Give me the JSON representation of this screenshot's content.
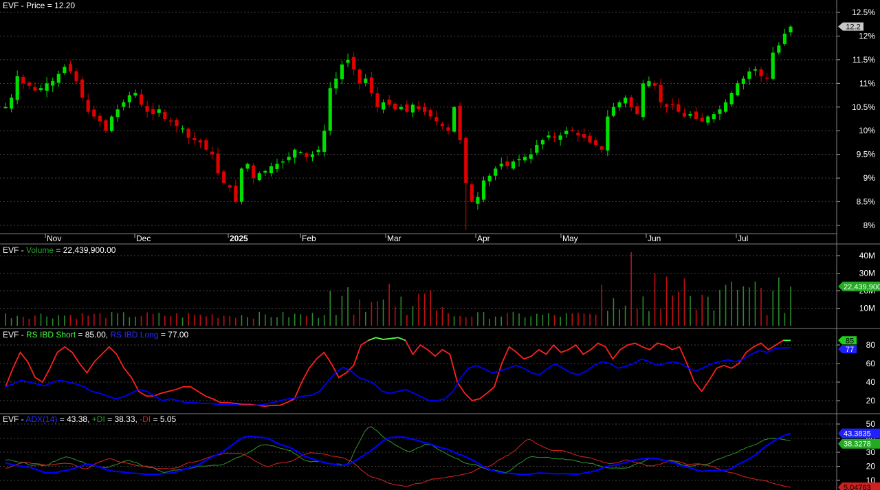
{
  "symbol": "EVF",
  "sep": " - ",
  "eq": " = ",
  "colors": {
    "background": "#000000",
    "up": "#00e000",
    "down": "#e00000",
    "blue": "#0000ff",
    "text": "#ffffff",
    "grid": "#444444",
    "red_line": "#ff2020",
    "green_line": "#44ff44",
    "dark_green": "#2a8a2a",
    "dark_red": "#c01010",
    "di_minus_red": "#d02020"
  },
  "x_axis": {
    "labels": [
      "Nov",
      "Dec",
      "2025",
      "Feb",
      "Mar",
      "Apr",
      "May",
      "Jun",
      "Jul"
    ],
    "bold": [
      false,
      false,
      true,
      false,
      false,
      false,
      false,
      false,
      false
    ]
  },
  "panels": {
    "price": {
      "label": "Price",
      "value": "12.20",
      "ticks": [
        "12.5%",
        "12%",
        "11.5%",
        "11%",
        "10.5%",
        "10%",
        "9.5%",
        "9%",
        "8.5%",
        "8%"
      ],
      "tick_values": [
        12.5,
        12,
        11.5,
        11,
        10.5,
        10,
        9.5,
        9,
        8.5,
        8
      ],
      "last_tag": "12.2"
    },
    "volume": {
      "label": "Volume",
      "value": "22,439,900.00",
      "ticks": [
        "40M",
        "30M",
        "20M",
        "10M"
      ],
      "tick_values": [
        40,
        30,
        20,
        10
      ],
      "last_tag": "22,439,900"
    },
    "rs": {
      "label1": "RS IBD Short",
      "value1": "85.00",
      "label2": "RS IBD Long",
      "value2": "77.00",
      "ticks": [
        "80",
        "60",
        "40",
        "20"
      ],
      "tick_values": [
        80,
        60,
        40,
        20
      ],
      "tag1": "85",
      "tag2": "77"
    },
    "adx": {
      "label1": "ADX(14)",
      "value1": "43.38",
      "label2": "+DI",
      "value2": "38.33",
      "label3": "-DI",
      "value3": "5.05",
      "ticks": [
        "50",
        "40",
        "30",
        "20",
        "10"
      ],
      "tick_values": [
        50,
        40,
        30,
        20,
        10
      ],
      "tag_adx": "43.3835",
      "tag_pdi": "38.3278",
      "tag_mdi": "5.04763"
    }
  },
  "chart_data": [
    {
      "type": "candlestick",
      "title": "EVF - Price = 12.20",
      "x_labels": [
        "Nov",
        "Dec",
        "2025",
        "Feb",
        "Mar",
        "Apr",
        "May",
        "Jun",
        "Jul"
      ],
      "ylim": [
        7.8,
        12.65
      ],
      "closes_approx": [
        10.5,
        10.7,
        11.15,
        11.0,
        10.95,
        10.85,
        10.9,
        11.0,
        11.05,
        11.2,
        11.35,
        11.25,
        11.05,
        10.7,
        10.4,
        10.3,
        10.2,
        10.0,
        10.3,
        10.45,
        10.6,
        10.75,
        10.8,
        10.55,
        10.4,
        10.35,
        10.45,
        10.25,
        10.2,
        10.1,
        10.05,
        9.85,
        9.8,
        9.75,
        9.6,
        9.5,
        9.1,
        8.9,
        8.8,
        8.5,
        9.2,
        9.3,
        9.0,
        9.1,
        9.15,
        9.25,
        9.3,
        9.35,
        9.45,
        9.6,
        9.55,
        9.45,
        9.5,
        9.6,
        10.0,
        10.9,
        11.1,
        11.4,
        11.5,
        11.3,
        11.0,
        11.1,
        10.8,
        10.5,
        10.6,
        10.55,
        10.45,
        10.5,
        10.4,
        10.55,
        10.45,
        10.4,
        10.3,
        10.2,
        10.1,
        10.0,
        10.5,
        9.8,
        8.9,
        8.5,
        8.6,
        8.95,
        9.05,
        9.2,
        9.3,
        9.25,
        9.35,
        9.4,
        9.45,
        9.5,
        9.7,
        9.8,
        9.9,
        9.85,
        9.9,
        10.0,
        10.0,
        9.9,
        9.85,
        9.75,
        9.7,
        9.6,
        10.3,
        10.5,
        10.6,
        10.7,
        10.5,
        10.35,
        11.0,
        11.05,
        10.95,
        10.6,
        10.5,
        10.55,
        10.4,
        10.3,
        10.35,
        10.25,
        10.2,
        10.3,
        10.35,
        10.45,
        10.6,
        10.8,
        11.0,
        11.1,
        11.25,
        11.3,
        11.15,
        11.1,
        11.65,
        11.8,
        12.05,
        12.2
      ]
    },
    {
      "type": "bar",
      "title": "EVF - Volume = 22,439,900.00",
      "unit": "M",
      "ylim": [
        0,
        45
      ],
      "last_value": 22.44,
      "peak_value": 42
    },
    {
      "type": "line",
      "title": "EVF - RS IBD Short = 85.00, RS IBD Long = 77.00",
      "ylim": [
        10,
        95
      ],
      "series": [
        {
          "name": "RS IBD Short",
          "last": 85,
          "values": [
            35,
            55,
            72,
            62,
            45,
            40,
            55,
            72,
            78,
            72,
            60,
            50,
            62,
            70,
            78,
            70,
            55,
            45,
            30,
            25,
            25,
            28,
            30,
            32,
            35,
            35,
            30,
            25,
            22,
            18,
            18,
            17,
            16,
            16,
            15,
            14,
            15,
            15,
            18,
            22,
            40,
            55,
            65,
            72,
            60,
            45,
            50,
            58,
            80,
            85,
            88,
            86,
            87,
            88,
            85,
            70,
            80,
            75,
            68,
            75,
            70,
            40,
            28,
            20,
            22,
            28,
            35,
            60,
            78,
            72,
            65,
            68,
            75,
            70,
            80,
            72,
            75,
            80,
            70,
            75,
            82,
            78,
            65,
            75,
            80,
            82,
            78,
            75,
            82,
            80,
            75,
            78,
            60,
            40,
            30,
            42,
            55,
            58,
            55,
            60,
            72,
            78,
            82,
            75,
            80,
            85,
            85
          ]
        },
        {
          "name": "RS IBD Long",
          "last": 77,
          "values": [
            35,
            38,
            42,
            40,
            38,
            36,
            40,
            42,
            40,
            38,
            35,
            30,
            28,
            25,
            22,
            24,
            28,
            32,
            30,
            25,
            20,
            22,
            20,
            18,
            18,
            17,
            17,
            16,
            16,
            16,
            15,
            15,
            15,
            16,
            18,
            20,
            22,
            23,
            25,
            26,
            30,
            40,
            50,
            56,
            52,
            45,
            42,
            38,
            30,
            28,
            30,
            32,
            28,
            24,
            20,
            20,
            22,
            30,
            45,
            55,
            58,
            54,
            50,
            52,
            55,
            58,
            55,
            50,
            48,
            54,
            60,
            55,
            50,
            48,
            52,
            58,
            62,
            60,
            55,
            57,
            60,
            65,
            62,
            58,
            60,
            62,
            60,
            55,
            52,
            56,
            60,
            62,
            64,
            62,
            65,
            70,
            74,
            72,
            76,
            77,
            77
          ]
        }
      ]
    },
    {
      "type": "line",
      "title": "EVF - ADX(14) = 43.38, +DI = 38.33, -DI = 5.05",
      "ylim": [
        3,
        55
      ],
      "series": [
        {
          "name": "ADX(14)",
          "last": 43.3835
        },
        {
          "name": "+DI",
          "last": 38.3278
        },
        {
          "name": "-DI",
          "last": 5.04763
        }
      ]
    }
  ]
}
